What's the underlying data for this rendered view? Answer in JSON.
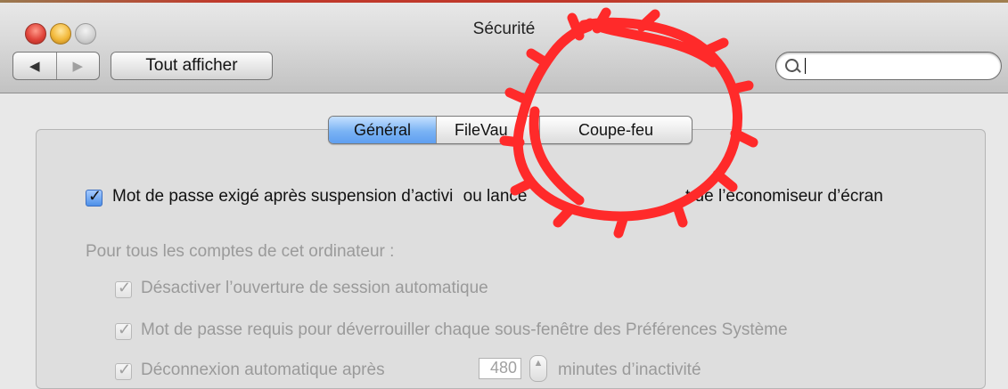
{
  "window": {
    "title": "Sécurité"
  },
  "toolbar": {
    "back_glyph": "◀",
    "forward_glyph": "▶",
    "show_all_label": "Tout afficher",
    "search_value": "",
    "search_placeholder": ""
  },
  "tabs": [
    {
      "label": "Général",
      "selected": true
    },
    {
      "label": "FileVau",
      "selected": false
    },
    {
      "label": "Coupe-feu",
      "selected": false
    }
  ],
  "general": {
    "password_after_sleep": {
      "checked": true,
      "label": "Mot de passe exigé après suspension d’activité ou lancement de l’économiseur d’écran",
      "visible_left": "Mot de passe exigé après suspension d’activi",
      "visible_mid": "ou lance",
      "visible_right": "t de l’économiseur d’écran"
    },
    "all_accounts_label": "Pour tous les comptes de cet ordinateur :",
    "disable_auto_login": {
      "checked": true,
      "enabled": false,
      "label": "Désactiver l’ouverture de session automatique"
    },
    "require_password_unlock": {
      "checked": true,
      "enabled": false,
      "label": "Mot de passe requis pour déverrouiller chaque sous-fenêtre des Préférences Système"
    },
    "auto_logout": {
      "checked": true,
      "enabled": false,
      "label_before": "Déconnexion automatique après",
      "minutes": "480",
      "label_after": "minutes d’inactivité"
    }
  },
  "annotation": {
    "color": "#ff2a2a",
    "shape": "scribbled-circle"
  },
  "colors": {
    "selected_tab": "#6aa6f2",
    "checkbox_checked": "#4d8fe8"
  },
  "icons": [
    "close-icon",
    "minimize-icon",
    "zoom-icon",
    "back-icon",
    "forward-icon",
    "search-icon",
    "checkmark-icon",
    "stepper-arrow-icon"
  ]
}
